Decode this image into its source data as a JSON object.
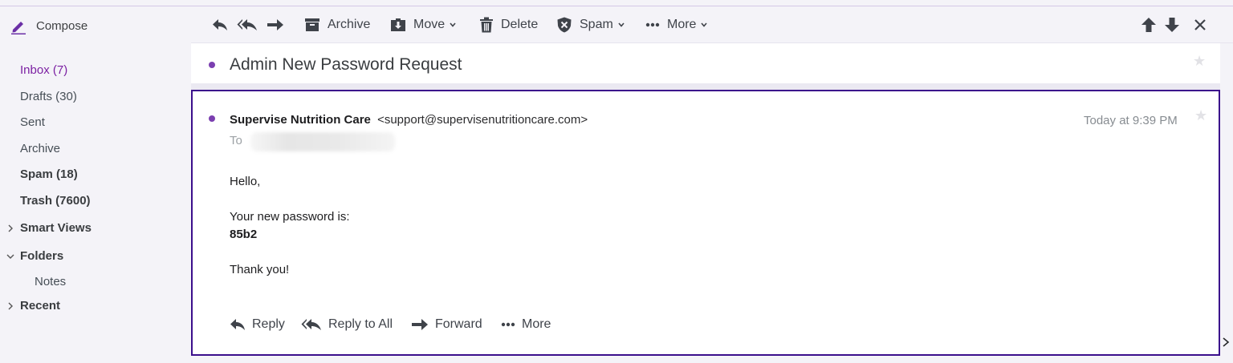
{
  "sidebar": {
    "compose_label": "Compose",
    "folders": [
      {
        "label": "Inbox (7)"
      },
      {
        "label": "Drafts (30)"
      },
      {
        "label": "Sent"
      },
      {
        "label": "Archive"
      },
      {
        "label": "Spam (18)"
      },
      {
        "label": "Trash (7600)"
      }
    ],
    "smart_views_label": "Smart Views",
    "folders_label": "Folders",
    "notes_label": "Notes",
    "recent_label": "Recent"
  },
  "toolbar": {
    "archive_label": "Archive",
    "move_label": "Move",
    "delete_label": "Delete",
    "spam_label": "Spam",
    "more_label": "More"
  },
  "message": {
    "subject": "Admin New Password Request",
    "sender_name": "Supervise Nutrition Care",
    "sender_email": "<support@supervisenutritioncare.com>",
    "date": "Today at 9:39 PM",
    "to_label": "To",
    "body": {
      "greeting": "Hello,",
      "line1": "Your new password is:",
      "password": "85b2",
      "closing": "Thank you!"
    }
  },
  "actions": {
    "reply_label": "Reply",
    "reply_all_label": "Reply to All",
    "forward_label": "Forward",
    "more_label": "More"
  },
  "colors": {
    "accent": "#7b1fa2",
    "card_border": "#3b0f8c",
    "unread_dot": "#7b3fb0"
  }
}
